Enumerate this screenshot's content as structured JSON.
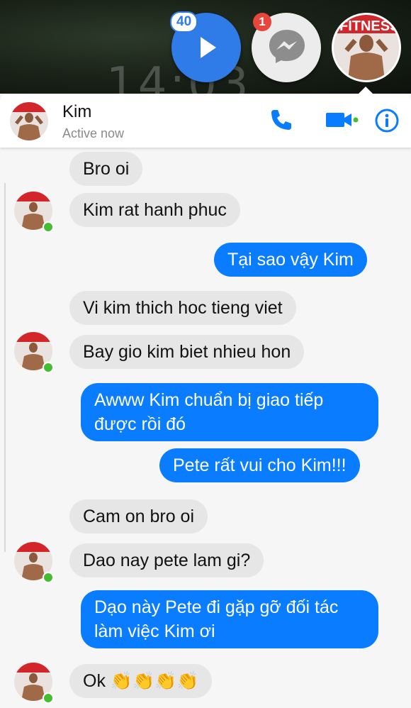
{
  "chat_heads": {
    "video_badge": "40",
    "messenger_badge": "1"
  },
  "wallpaper_clock": "14:03",
  "conversation": {
    "contact_name": "Kim",
    "contact_status": "Active now",
    "accent_color": "#0a7cff",
    "icons": [
      "phone-icon",
      "video-camera-icon",
      "info-icon"
    ]
  },
  "messages": [
    {
      "from": "contact",
      "text": "Bro oi"
    },
    {
      "from": "contact",
      "text": "Kim rat hanh phuc"
    },
    {
      "from": "me",
      "text": "Tại sao vậy Kim"
    },
    {
      "from": "contact",
      "text": "Vi kim thich hoc tieng viet"
    },
    {
      "from": "contact",
      "text": "Bay gio kim biet nhieu hon"
    },
    {
      "from": "me",
      "text": "Awww Kim chuẩn bị giao tiếp được rồi đó"
    },
    {
      "from": "me",
      "text": "Pete rất vui cho Kim!!!"
    },
    {
      "from": "contact",
      "text": "Cam on bro oi"
    },
    {
      "from": "contact",
      "text": "Dao nay pete lam gi?"
    },
    {
      "from": "me",
      "text": "Dạo này Pete đi gặp gỡ đối tác làm việc Kim ơi"
    },
    {
      "from": "contact",
      "text": "Ok 👏👏👏👏"
    }
  ]
}
